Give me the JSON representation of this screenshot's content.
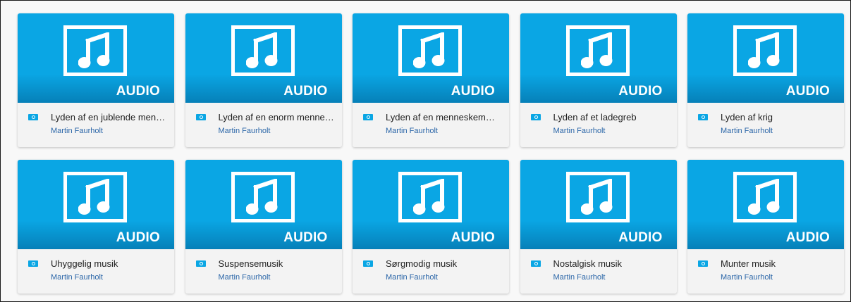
{
  "theme": {
    "accent": "#0aa6e4",
    "accent_dark": "#0680b8",
    "author_color": "#2b66a8"
  },
  "badge_label": "AUDIO",
  "cards": [
    {
      "title": "Lyden af en jublende menneskemængde",
      "author": "Martin Faurholt",
      "type_icon": "audio-type-icon",
      "thumb_icon": "music-note-icon"
    },
    {
      "title": "Lyden af en enorm menneskemængde",
      "author": "Martin Faurholt",
      "type_icon": "audio-type-icon",
      "thumb_icon": "music-note-icon"
    },
    {
      "title": "Lyden af en menneskemængde",
      "author": "Martin Faurholt",
      "type_icon": "audio-type-icon",
      "thumb_icon": "music-note-icon"
    },
    {
      "title": "Lyden af et ladegreb",
      "author": "Martin Faurholt",
      "type_icon": "audio-type-icon",
      "thumb_icon": "music-note-icon"
    },
    {
      "title": "Lyden af krig",
      "author": "Martin Faurholt",
      "type_icon": "audio-type-icon",
      "thumb_icon": "music-note-icon"
    },
    {
      "title": "Uhyggelig musik",
      "author": "Martin Faurholt",
      "type_icon": "audio-type-icon",
      "thumb_icon": "music-note-icon"
    },
    {
      "title": "Suspensemusik",
      "author": "Martin Faurholt",
      "type_icon": "audio-type-icon",
      "thumb_icon": "music-note-icon"
    },
    {
      "title": "Sørgmodig musik",
      "author": "Martin Faurholt",
      "type_icon": "audio-type-icon",
      "thumb_icon": "music-note-icon"
    },
    {
      "title": "Nostalgisk musik",
      "author": "Martin Faurholt",
      "type_icon": "audio-type-icon",
      "thumb_icon": "music-note-icon"
    },
    {
      "title": "Munter musik",
      "author": "Martin Faurholt",
      "type_icon": "audio-type-icon",
      "thumb_icon": "music-note-icon"
    }
  ]
}
